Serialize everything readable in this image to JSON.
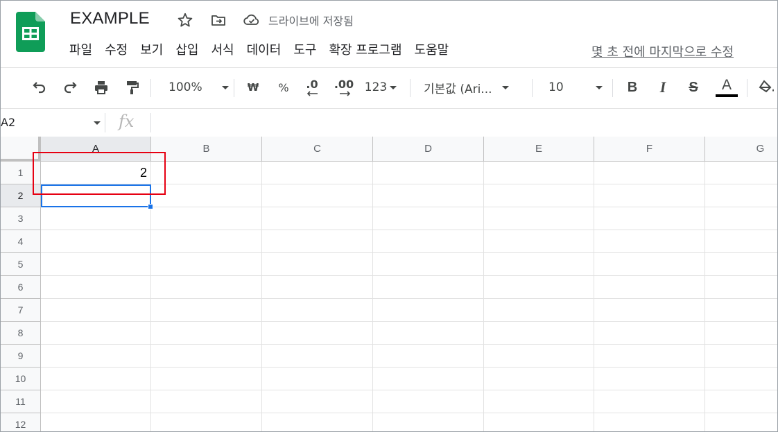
{
  "doc": {
    "title": "EXAMPLE",
    "save_status": "드라이브에 저장됨"
  },
  "menu": [
    "파일",
    "수정",
    "보기",
    "삽입",
    "서식",
    "데이터",
    "도구",
    "확장 프로그램",
    "도움말"
  ],
  "last_edit": "몇 초 전에 마지막으로 수정",
  "toolbar": {
    "zoom": "100%",
    "currency": "₩",
    "percent": "%",
    "decimal_decrease": ".0",
    "decimal_increase": ".00",
    "format_more": "123",
    "font": "기본값 (Ari...",
    "font_size": "10",
    "bold": "B",
    "italic": "I",
    "strike": "S",
    "text_color": "A"
  },
  "formula_bar": {
    "name_box": "A2",
    "fx": "fx"
  },
  "columns": [
    "A",
    "B",
    "C",
    "D",
    "E",
    "F",
    "G"
  ],
  "rows": [
    "1",
    "2",
    "3",
    "4",
    "5",
    "6",
    "7",
    "8",
    "9",
    "10",
    "11",
    "12"
  ],
  "cells": {
    "A1": "2"
  },
  "colors": {
    "accent": "#1a73e8",
    "highlight": "#e60012",
    "sheets_green": "#0f9d58"
  }
}
